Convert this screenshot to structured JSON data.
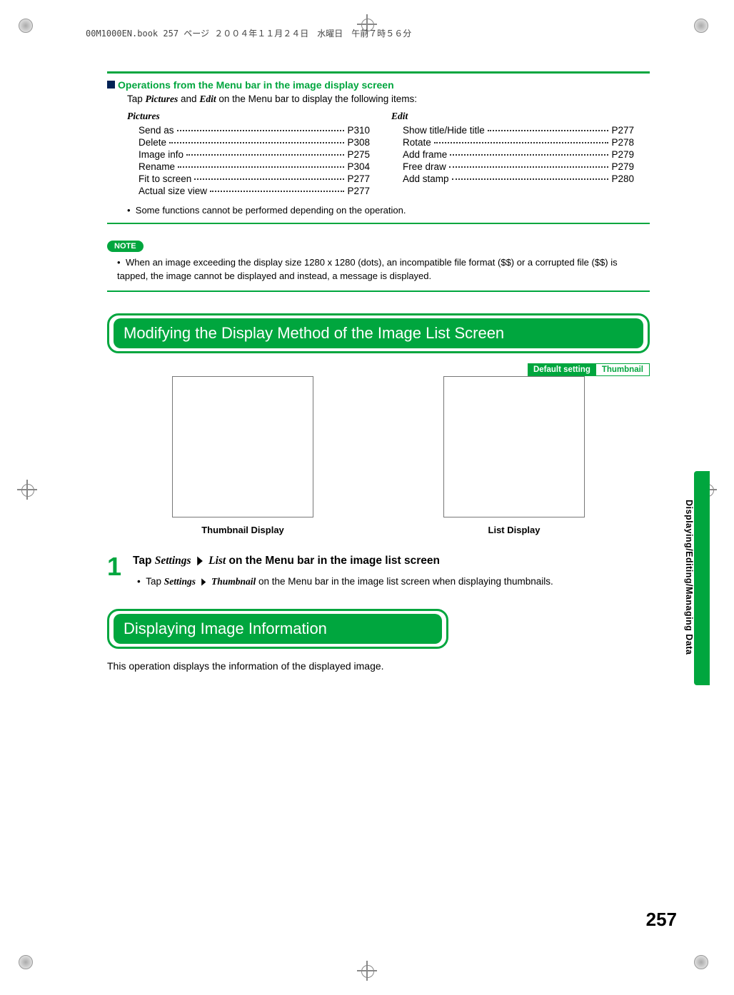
{
  "doc_header": "00M1000EN.book  257 ページ  ２００４年１１月２４日　水曜日　午前７時５６分",
  "operations": {
    "heading": "Operations from the Menu bar in the image display screen",
    "intro_pre": "Tap ",
    "intro_mid": " and ",
    "intro_post": " on the Menu bar to display the following items:",
    "pictures_label": "Pictures",
    "edit_label": "Edit",
    "pictures_items": [
      {
        "label": "Send as",
        "page": "P310"
      },
      {
        "label": "Delete",
        "page": "P308"
      },
      {
        "label": "Image info",
        "page": "P275"
      },
      {
        "label": "Rename",
        "page": "P304"
      },
      {
        "label": "Fit to screen",
        "page": "P277"
      },
      {
        "label": "Actual size view",
        "page": "P277"
      }
    ],
    "edit_items": [
      {
        "label": "Show title/Hide title",
        "page": "P277"
      },
      {
        "label": "Rotate",
        "page": "P278"
      },
      {
        "label": "Add frame",
        "page": "P279"
      },
      {
        "label": "Free draw",
        "page": "P279"
      },
      {
        "label": "Add stamp",
        "page": "P280"
      }
    ],
    "footnote": "Some functions cannot be performed depending on the operation."
  },
  "note": {
    "tag": "NOTE",
    "body": "When an image exceeding the display size 1280 x 1280 (dots), an incompatible file format ($$) or a corrupted file ($$) is tapped, the image cannot be displayed and instead, a message is displayed."
  },
  "section_modify": {
    "title": "Modifying the Display Method of the Image List Screen",
    "default_setting_label": "Default setting",
    "default_setting_value": "Thumbnail",
    "thumb_caption": "Thumbnail Display",
    "list_caption": "List Display"
  },
  "step1": {
    "number": "1",
    "title_pre": "Tap ",
    "title_settings": "Settings",
    "title_list": "List",
    "title_post": " on the Menu bar in the image list screen",
    "sub_pre": "Tap ",
    "sub_settings": "Settings",
    "sub_thumb": "Thumbnail",
    "sub_post": " on the Menu bar in the image list screen when displaying thumbnails."
  },
  "section_info": {
    "title": "Displaying Image Information",
    "body": "This operation displays the information of the displayed image."
  },
  "side_tab": "Displaying/Editing/Managing Data",
  "page_number": "257"
}
